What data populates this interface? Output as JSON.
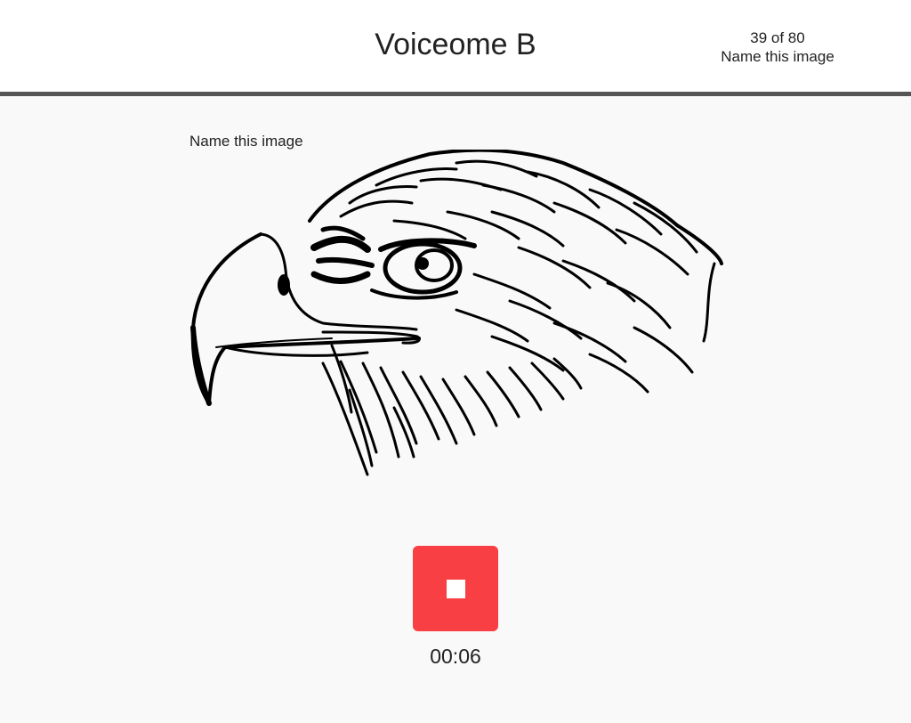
{
  "header": {
    "title": "Voiceome B",
    "progress": "39 of 80",
    "task_name": "Name this image"
  },
  "task": {
    "prompt": "Name this image",
    "image_icon": "eagle-head-drawing"
  },
  "recorder": {
    "stop_icon": "stop-square-icon",
    "elapsed": "00:06",
    "button_color": "#f83f44"
  }
}
